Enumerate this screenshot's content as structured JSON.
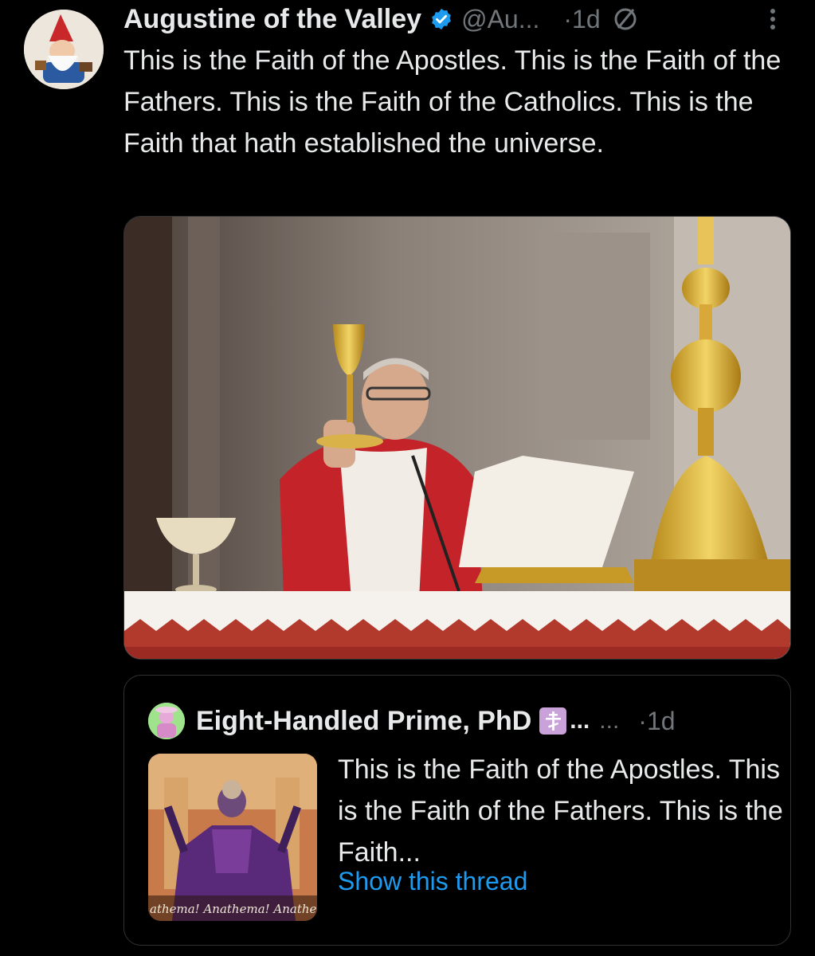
{
  "tweet": {
    "author_name": "Augustine of the Valley",
    "handle": "@Au...",
    "time": "·1d",
    "text": "This is the Faith of the Apostles. This is the Faith of the Fathers. This is the Faith of the Catholics. This is the Faith that hath established the universe."
  },
  "quote": {
    "author_name": "Eight-Handled Prime, PhD",
    "ellipsis": "...",
    "handle": "...",
    "time": "·1d",
    "text": "This is the Faith of the Apostles. This is the Faith of the Fathers. This is the Faith...",
    "show_thread": "Show this thread",
    "thumb_caption": "athema! Anathema! Anathem"
  },
  "colors": {
    "background": "#000000",
    "text": "#e7e9ea",
    "secondary": "#71767b",
    "link": "#1d9bf0",
    "verified": "#1d9bf0"
  }
}
